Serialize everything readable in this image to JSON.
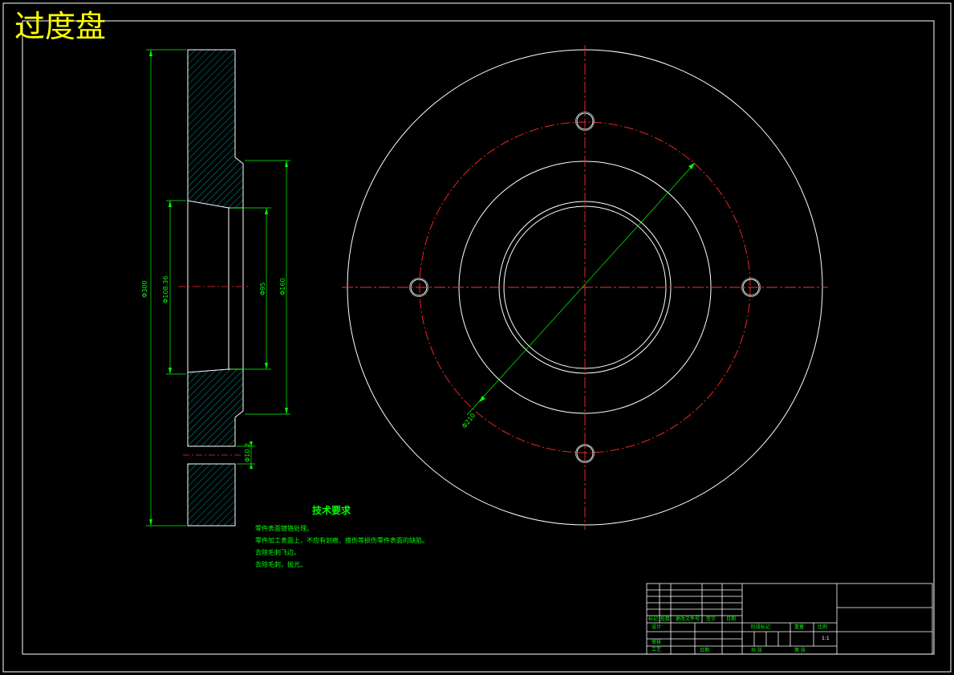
{
  "drawing": {
    "title": "过度盘",
    "colors": {
      "outline": "#ffffff",
      "dimension": "#00ff00",
      "centerline": "#ff2a2a",
      "title": "#ffff00",
      "hatch": "#00bcbc"
    },
    "dimensions": {
      "overall_height": "Φ300",
      "bore_a": "Φ108.36",
      "bore_b": "Φ95",
      "boss": "Φ160",
      "hole_gap": "Φ10.2",
      "pitch_circle": "Φ210"
    },
    "technical_requirements": {
      "title": "技术要求",
      "items": [
        "零件表面镀铬处理。",
        "零件加工表面上，不应有划痕、擦伤等损伤零件表面的缺陷。",
        "去除毛刺飞边。",
        "去除毛刺，抛光。"
      ]
    },
    "title_block": {
      "labels": [
        "标记",
        "处数",
        "更改文件号",
        "签字",
        "日期",
        "设计",
        "日期",
        "审核",
        "工艺",
        "阶段标记",
        "重量",
        "比例",
        "共 张",
        "第 张"
      ],
      "scale": "1:1"
    }
  }
}
